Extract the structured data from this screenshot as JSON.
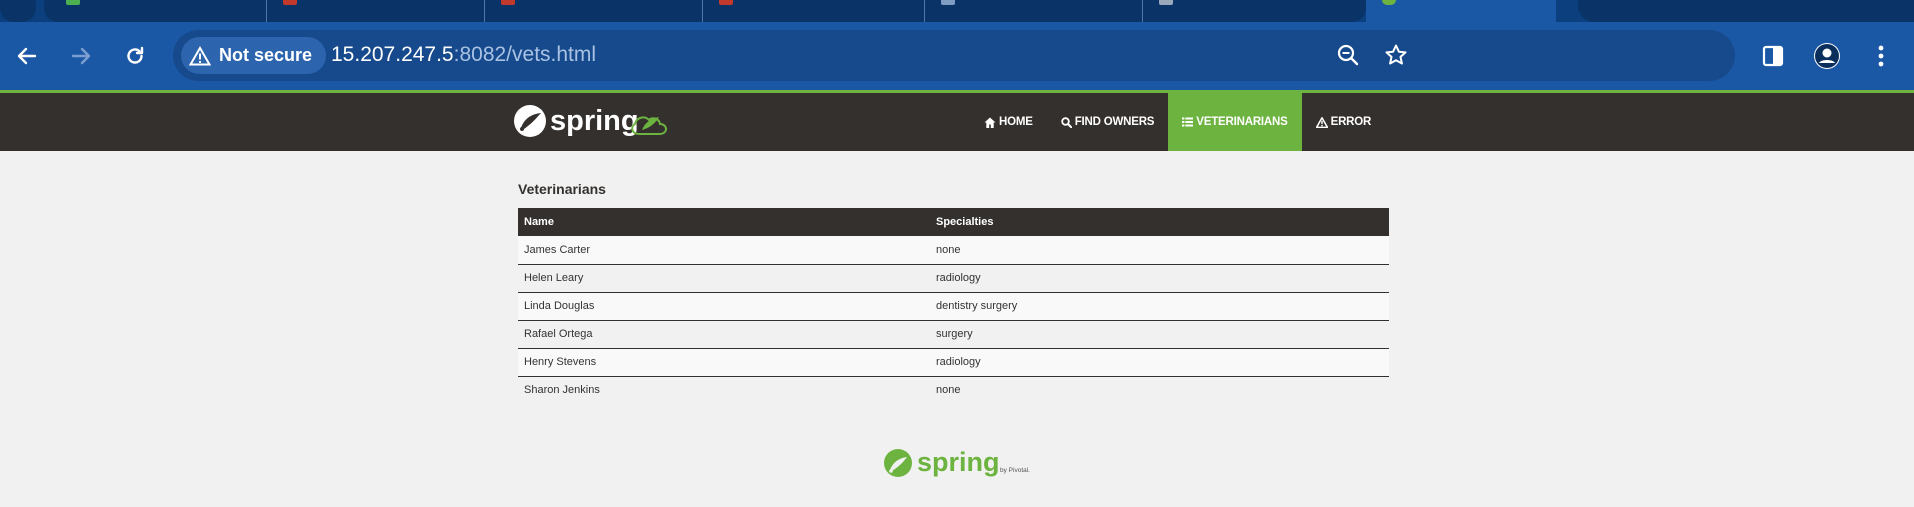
{
  "browser": {
    "tabs": [
      {
        "favicon_color": "#4caf50"
      },
      {
        "favicon_color": "#c0392b"
      },
      {
        "favicon_color": "#c0392b"
      },
      {
        "favicon_color": "#c0392b"
      },
      {
        "favicon_color": "#7f9cc3"
      },
      {
        "favicon_color": "#9aa8bb"
      }
    ],
    "active_tab": {
      "favicon_color": "#6db33f"
    },
    "security_label": "Not secure",
    "url_host": "15.207.247.5",
    "url_rest": ":8082/vets.html",
    "icons": [
      "back-arrow-icon",
      "forward-arrow-icon",
      "reload-icon",
      "warning-icon",
      "zoom-icon",
      "star-icon",
      "side-panel-icon",
      "profile-icon",
      "menu-dots-icon"
    ]
  },
  "navbar": {
    "brand": "spring",
    "items": [
      {
        "label": "HOME",
        "icon": "home-icon",
        "active": false
      },
      {
        "label": "FIND OWNERS",
        "icon": "search-icon",
        "active": false
      },
      {
        "label": "VETERINARIANS",
        "icon": "list-icon",
        "active": true
      },
      {
        "label": "ERROR",
        "icon": "warning-icon",
        "active": false
      }
    ]
  },
  "page": {
    "title": "Veterinarians",
    "table": {
      "headers": [
        "Name",
        "Specialties"
      ],
      "rows": [
        [
          "James Carter",
          "none"
        ],
        [
          "Helen Leary",
          "radiology"
        ],
        [
          "Linda Douglas",
          "dentistry surgery"
        ],
        [
          "Rafael Ortega",
          "surgery"
        ],
        [
          "Henry Stevens",
          "radiology"
        ],
        [
          "Sharon Jenkins",
          "none"
        ]
      ]
    }
  },
  "footer": {
    "brand": "spring",
    "byline": "by Pivotal."
  },
  "colors": {
    "spring_green": "#6db33f",
    "nav_dark": "#34302d",
    "chrome_blue": "#1a57a5"
  }
}
